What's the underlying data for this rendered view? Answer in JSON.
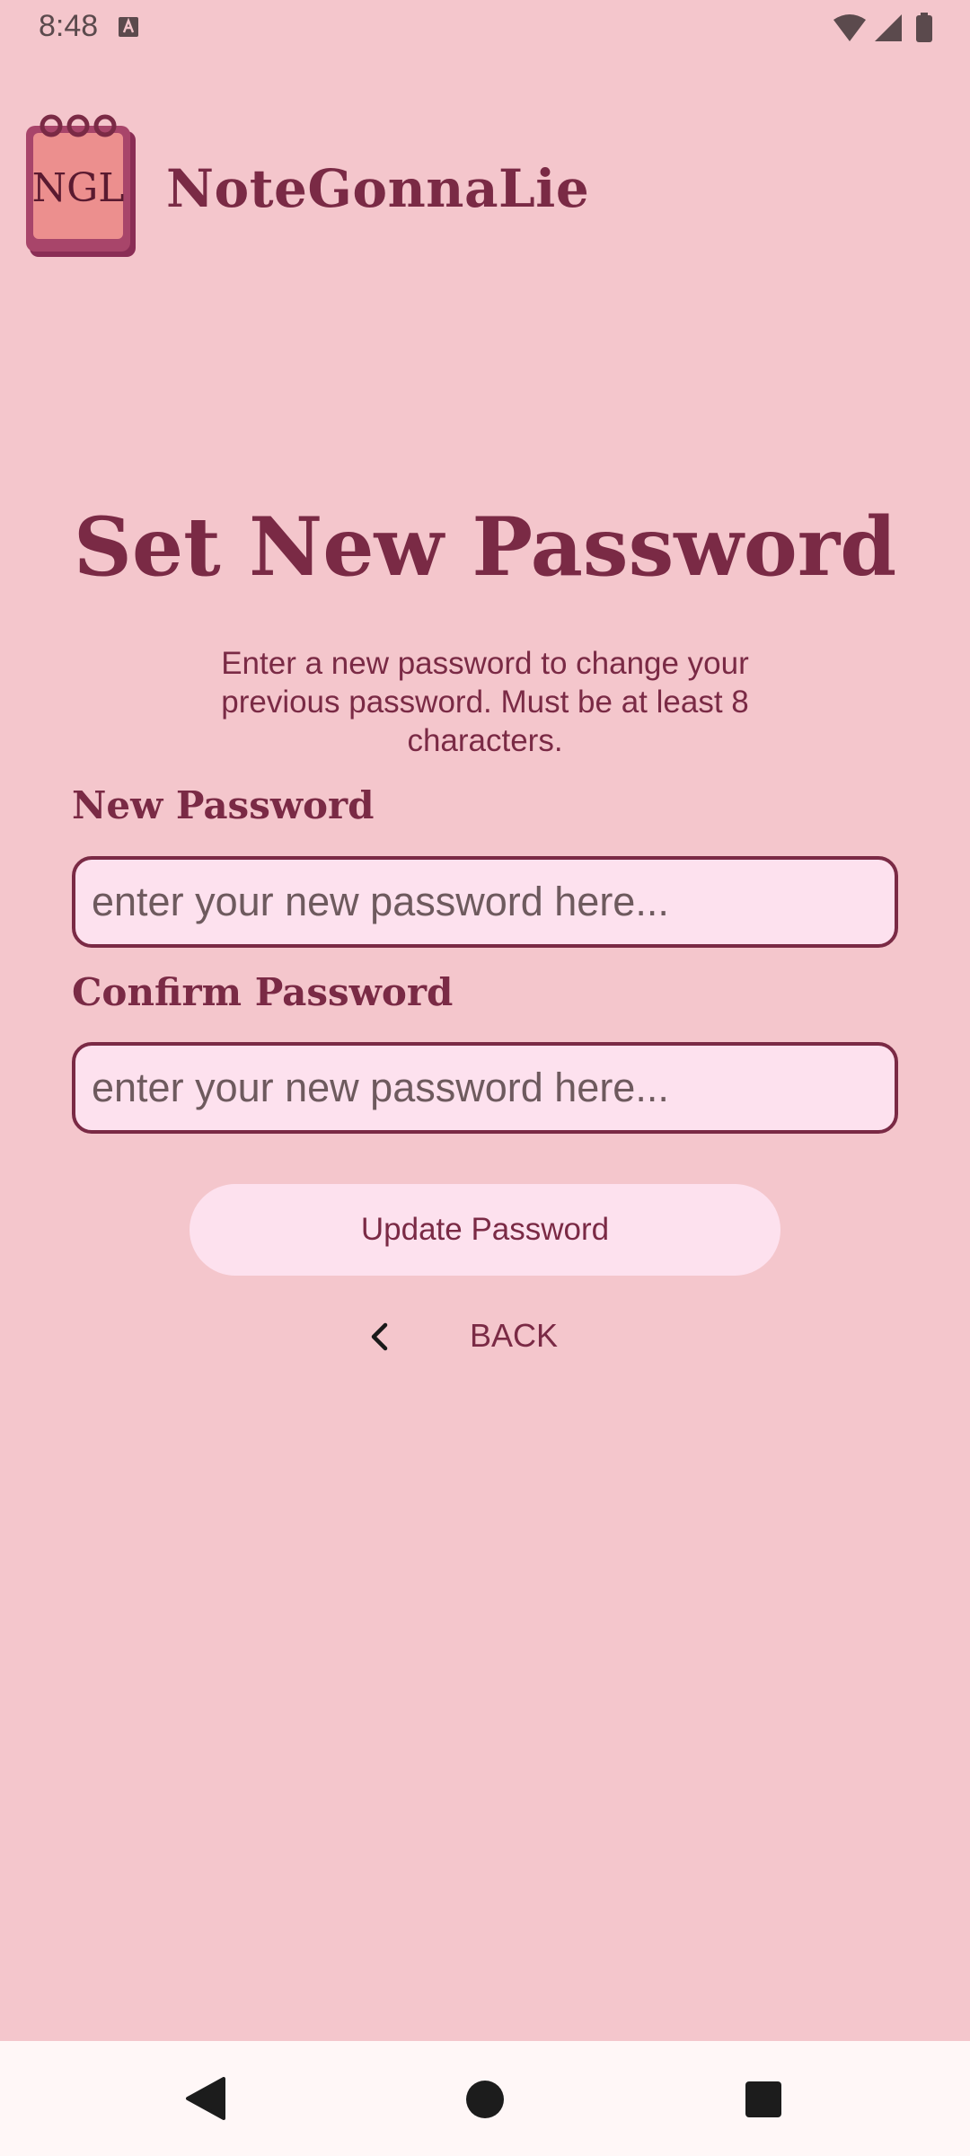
{
  "status_bar": {
    "time": "8:48",
    "icons": [
      "keyboard-a-icon",
      "wifi-icon",
      "signal-icon",
      "battery-icon"
    ]
  },
  "app": {
    "logo_text": "NGL",
    "name": "NoteGonnaLie"
  },
  "page": {
    "title": "Set New Password",
    "subtitle": "Enter a new password to change your previous password. Must be at least 8 characters."
  },
  "form": {
    "new_password": {
      "label": "New Password",
      "value": "",
      "placeholder": "enter your new password here..."
    },
    "confirm_password": {
      "label": "Confirm Password",
      "value": "",
      "placeholder": "enter your new password here..."
    },
    "update_label": "Update Password",
    "back_label": "BACK"
  },
  "nav_bar": {
    "icons": [
      "nav-back-icon",
      "nav-home-icon",
      "nav-recents-icon"
    ]
  },
  "colors": {
    "background": "#f4c6cc",
    "primary": "#7a2a45",
    "field_fill": "#fde1ee",
    "nav_bar": "#fff7f7"
  }
}
